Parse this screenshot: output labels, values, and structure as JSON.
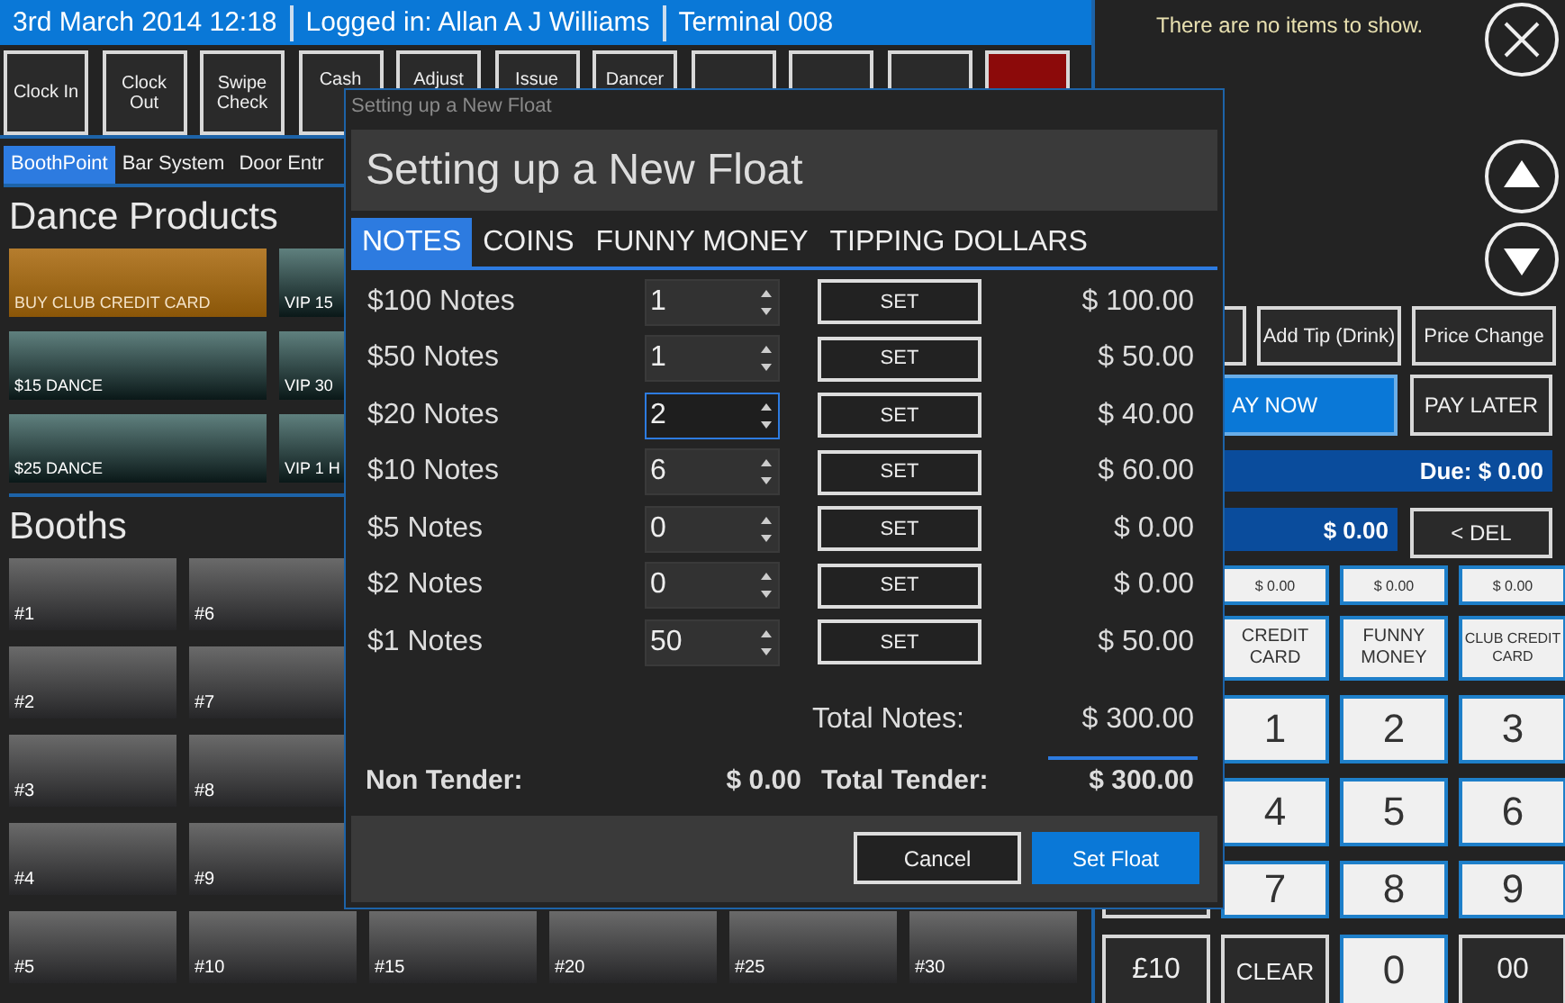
{
  "header": {
    "datetime": "3rd March 2014 12:18",
    "user": "Logged in: Allan A J Williams",
    "terminal": "Terminal 008"
  },
  "function_buttons": [
    {
      "label": "Clock In",
      "kind": "normal"
    },
    {
      "label": "Clock Out",
      "kind": "normal"
    },
    {
      "label": "Swipe Check",
      "kind": "normal"
    },
    {
      "label": "Cash",
      "kind": "normal"
    },
    {
      "label": "Adjust",
      "kind": "normal"
    },
    {
      "label": "Issue",
      "kind": "normal"
    },
    {
      "label": "Dancer",
      "kind": "normal"
    },
    {
      "kind": "normal"
    },
    {
      "kind": "normal"
    },
    {
      "kind": "normal"
    },
    {
      "kind": "danger"
    }
  ],
  "nav_tabs": [
    {
      "label": "BoothPoint",
      "selected": true
    },
    {
      "label": "Bar System",
      "selected": false
    },
    {
      "label": "Door Entr",
      "selected": false
    }
  ],
  "dance_products": {
    "title": "Dance Products",
    "items": [
      {
        "label": "BUY CLUB CREDIT CARD",
        "kind": "credit"
      },
      {
        "label": "VIP 15",
        "kind": "dance"
      },
      {
        "label": "$15 DANCE",
        "kind": "dance"
      },
      {
        "label": "VIP 30",
        "kind": "dance"
      },
      {
        "label": "$25 DANCE",
        "kind": "dance"
      },
      {
        "label": "VIP 1 H",
        "kind": "dance"
      }
    ]
  },
  "booths": {
    "title": "Booths",
    "columns": [
      [
        "#1",
        "#2",
        "#3",
        "#4",
        "#5"
      ],
      [
        "#6",
        "#7",
        "#8",
        "#9",
        "#10"
      ],
      [
        "#15"
      ],
      [
        "#20"
      ],
      [
        "#25"
      ],
      [
        "#30"
      ]
    ]
  },
  "order_panel": {
    "empty_message": "There are no items to show."
  },
  "action_buttons": [
    "Add Tip (Drink)",
    "Price Change"
  ],
  "pay_now": "AY NOW",
  "pay_later": "PAY LATER",
  "due": "Due: $ 0.00",
  "entry": "$ 0.00",
  "delete": "< DEL",
  "tender_amounts": [
    "$ 0.00",
    "$ 0.00",
    "$ 0.00"
  ],
  "tender_types": [
    "CREDIT CARD",
    "FUNNY MONEY",
    "CLUB CREDIT CARD"
  ],
  "keypad": [
    "1",
    "2",
    "3",
    "4",
    "5",
    "6",
    "7",
    "8",
    "9"
  ],
  "bottom_keys": [
    {
      "label": "£10",
      "kind": "dark"
    },
    {
      "label": "CLEAR",
      "kind": "dark"
    },
    {
      "label": "0",
      "kind": "light"
    },
    {
      "label": "00",
      "kind": "dark"
    }
  ],
  "dialog": {
    "window_title": "Setting up a New Float",
    "heading": "Setting up a New Float",
    "tabs": [
      {
        "label": "NOTES",
        "selected": true
      },
      {
        "label": "COINS",
        "selected": false
      },
      {
        "label": "FUNNY MONEY",
        "selected": false
      },
      {
        "label": "TIPPING DOLLARS",
        "selected": false
      }
    ],
    "rows": [
      {
        "label": "$100 Notes",
        "quantity": "1",
        "focused": false,
        "button": "SET",
        "amount": "$ 100.00"
      },
      {
        "label": "$50 Notes",
        "quantity": "1",
        "focused": false,
        "button": "SET",
        "amount": "$ 50.00"
      },
      {
        "label": "$20 Notes",
        "quantity": "2",
        "focused": true,
        "button": "SET",
        "amount": "$ 40.00"
      },
      {
        "label": "$10 Notes",
        "quantity": "6",
        "focused": false,
        "button": "SET",
        "amount": "$ 60.00"
      },
      {
        "label": "$5 Notes",
        "quantity": "0",
        "focused": false,
        "button": "SET",
        "amount": "$ 0.00"
      },
      {
        "label": "$2 Notes",
        "quantity": "0",
        "focused": false,
        "button": "SET",
        "amount": "$ 0.00"
      },
      {
        "label": "$1 Notes",
        "quantity": "50",
        "focused": false,
        "button": "SET",
        "amount": "$ 50.00"
      }
    ],
    "total_label": "Total Notes:",
    "total": "$ 300.00",
    "non_tender_label": "Non Tender:",
    "non_tender": "$ 0.00",
    "total_tender_label": "Total Tender:",
    "total_tender": "$ 300.00",
    "buttons": [
      {
        "label": "Cancel",
        "kind": "secondary"
      },
      {
        "label": "Set Float",
        "kind": "primary"
      }
    ]
  }
}
